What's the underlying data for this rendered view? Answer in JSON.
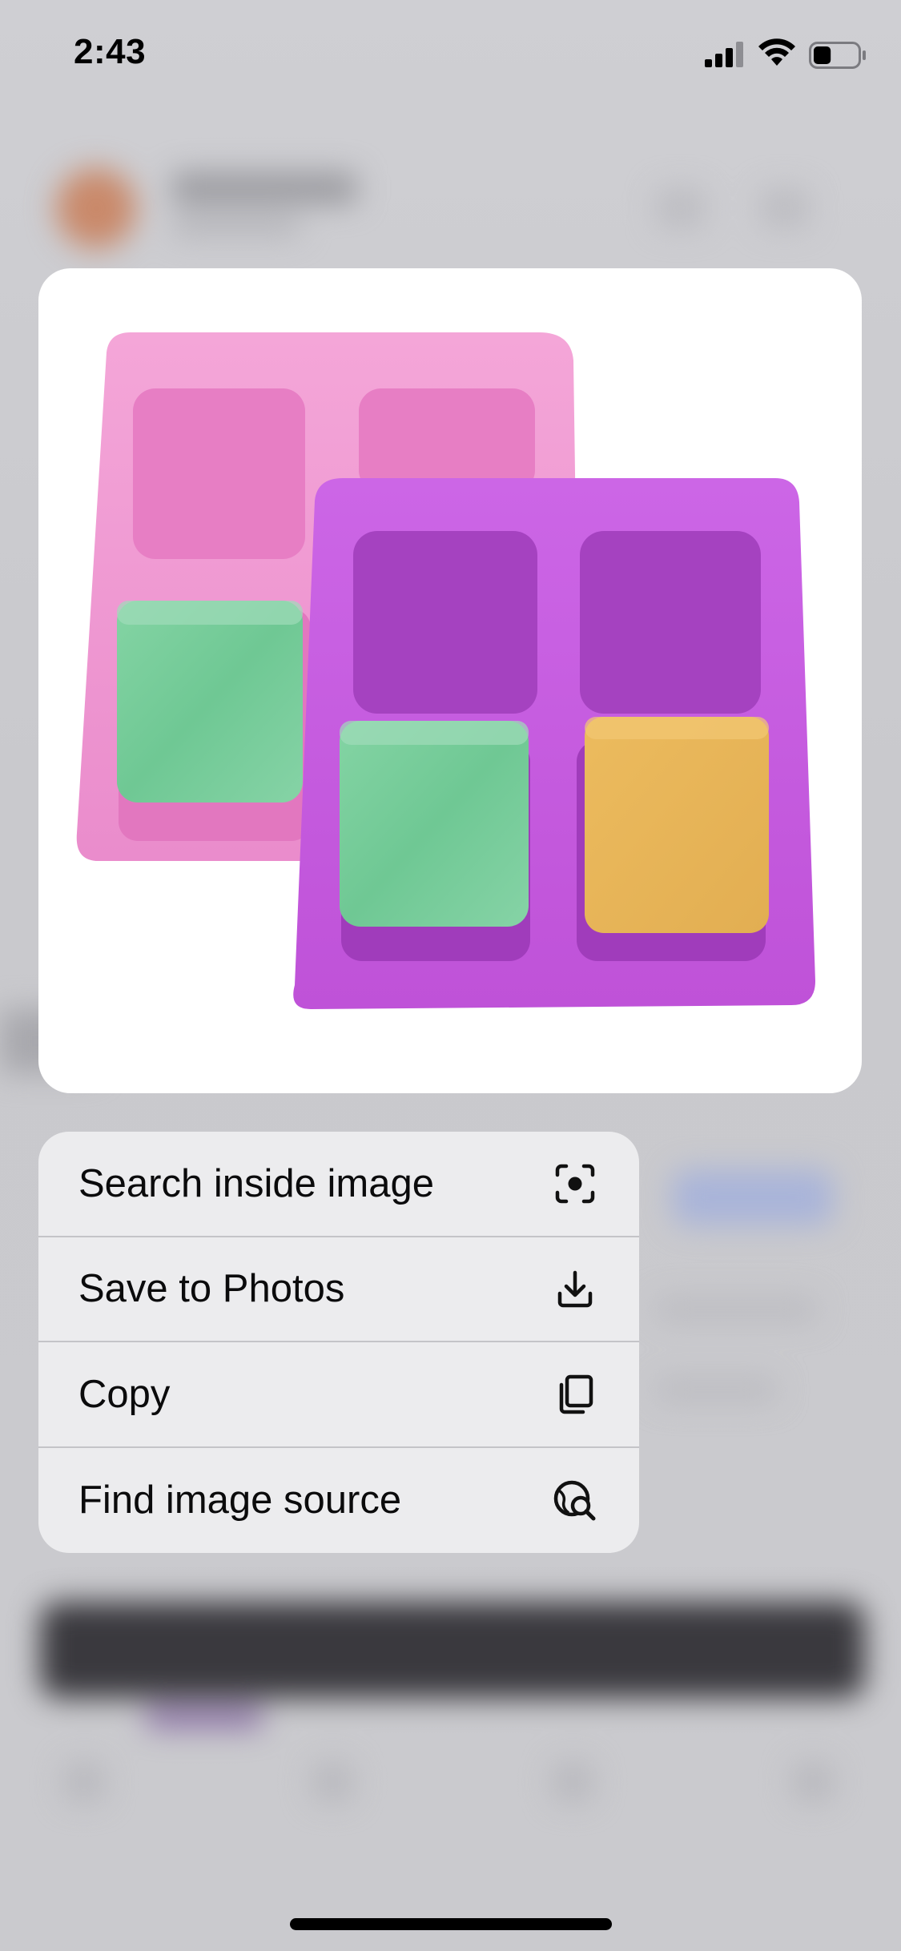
{
  "status_bar": {
    "time": "2:43",
    "signal_icon": "cellular-signal-icon",
    "wifi_icon": "wifi-icon",
    "battery_icon": "battery-icon",
    "battery_level": 0.4
  },
  "preview": {
    "image_description_icon": "soap-mold-image",
    "colors": {
      "pink_mold": "#f09ad2",
      "purple_mold": "#c65ce0",
      "green_soap": "#7fcf9f",
      "yellow_soap": "#e8b45a"
    }
  },
  "menu": {
    "items": [
      {
        "label": "Search inside image",
        "icon": "visual-search-icon"
      },
      {
        "label": "Save to Photos",
        "icon": "download-icon"
      },
      {
        "label": "Copy",
        "icon": "copy-icon"
      },
      {
        "label": "Find image source",
        "icon": "globe-search-icon"
      }
    ]
  }
}
